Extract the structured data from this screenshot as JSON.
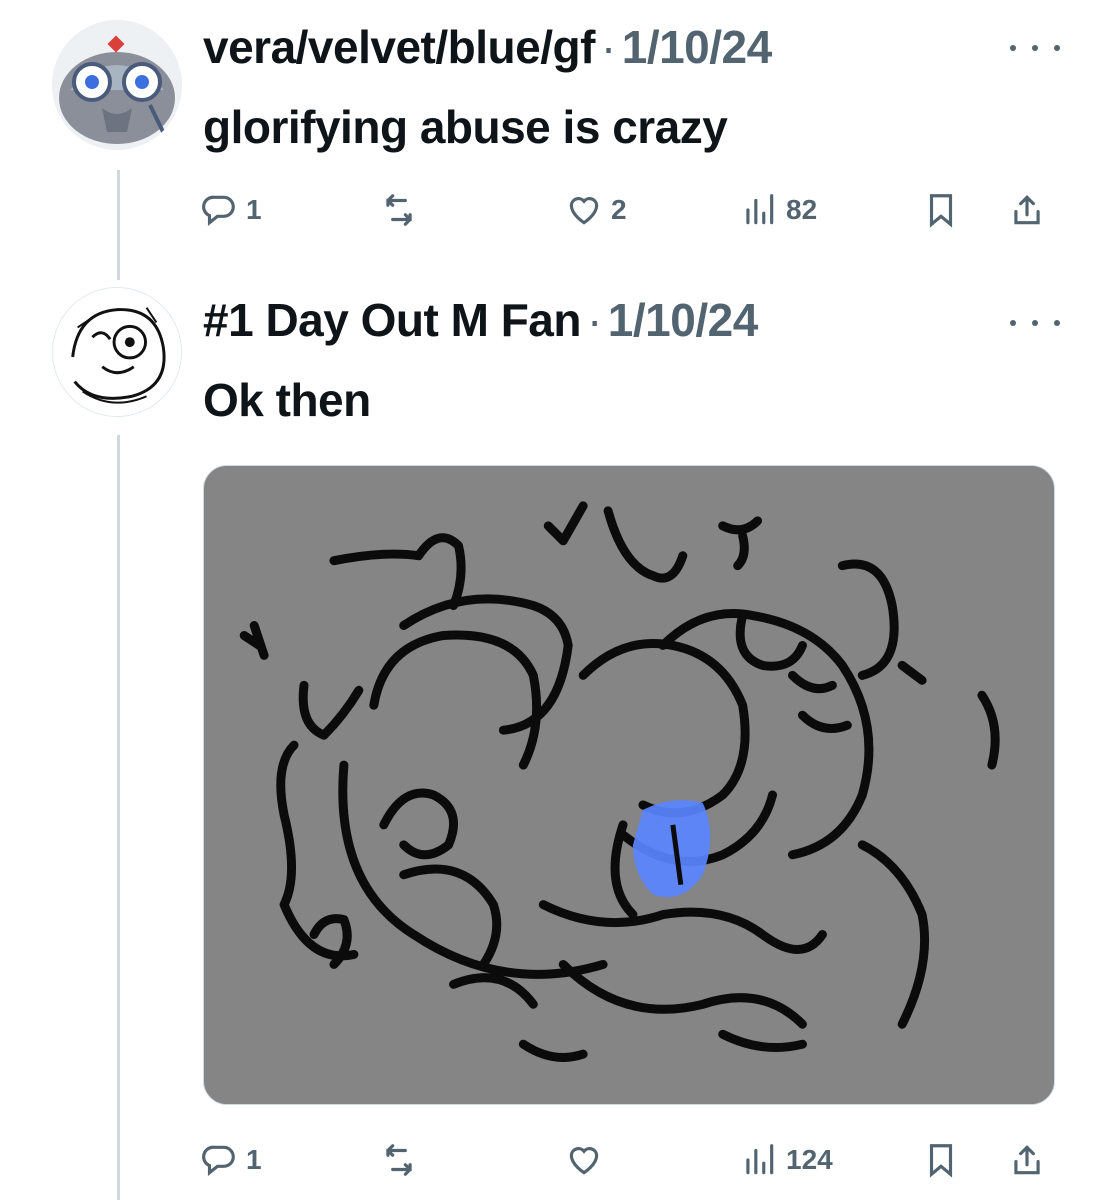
{
  "tweets": [
    {
      "author": "vera/velvet/blue/gf",
      "separator": "·",
      "date": "1/10/24",
      "text": "glorifying abuse is crazy",
      "avatar_icon": "avatar-robot-cat-icon",
      "actions": {
        "reply_count": "1",
        "retweet_count": "",
        "like_count": "2",
        "views_count": "82"
      }
    },
    {
      "author": "#1 Day Out M Fan",
      "separator": "·",
      "date": "1/10/24",
      "text": "Ok then",
      "avatar_icon": "avatar-sketch-icon",
      "media_icon": "sketch-drawing-image",
      "actions": {
        "reply_count": "1",
        "retweet_count": "",
        "like_count": "",
        "views_count": "124"
      }
    }
  ],
  "colors": {
    "text_primary": "#0f1419",
    "text_secondary": "#536471",
    "thread_line": "#cfd9de",
    "media_bg": "#858585",
    "accent_blue": "#5a86ff"
  }
}
